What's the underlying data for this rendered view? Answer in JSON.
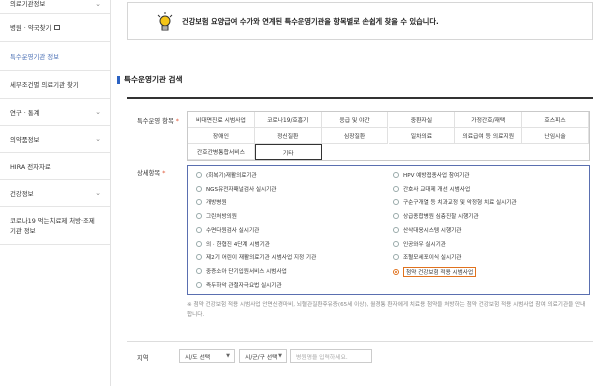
{
  "sidebar": {
    "items": [
      {
        "label": "의료기관정보",
        "chevron": true
      },
      {
        "label": "병원 · 약국찾기",
        "external": true
      },
      {
        "label": "특수운영기관 정보",
        "active": true
      },
      {
        "label": "세부조건별 의료기관 찾기"
      },
      {
        "label": "연구 · 통계",
        "chevron": true
      },
      {
        "label": "의약품정보",
        "chevron": true
      },
      {
        "label": "HIRA 전자자료"
      },
      {
        "label": "건강정보",
        "chevron": true
      },
      {
        "label": "코로나19 먹는치료제 처방·조제 기관 정보",
        "external": true
      }
    ]
  },
  "notice": {
    "text": "건강보험 요양급여 수가와 연계된 특수운영기관을 항목별로 손쉽게 찾을 수 있습니다."
  },
  "section": {
    "title": "특수운영기관 검색"
  },
  "labels": {
    "operation_item": "특수운영 항목",
    "detail_item": "상세항목",
    "region": "지역",
    "required": "*"
  },
  "operation_items": [
    "비대면진료 시범사업",
    "코로나19/호흡기",
    "응급 및 야간",
    "중환자실",
    "가정간호/재택",
    "호스피스",
    "장애인",
    "정신질환",
    "심장질환",
    "일차의료",
    "의료급여 등 의료지원",
    "난임시술",
    "간호간병통합서비스",
    "기타"
  ],
  "operation_selected": "기타",
  "detail_left": [
    "(회복기)재활의료기관",
    "NGS유전자패널검사 실시기관",
    "개방병원",
    "그린처방의원",
    "수면다원검사 실시기관",
    "의 · 한협진 4단계 시범기관",
    "제2기 어린이 재활의료기관 시범사업 지정 기관",
    "중증소아 단기입원서비스 시범사업",
    "즉두하악 관절자극요법 실시기관"
  ],
  "detail_right": [
    "HPV 예방접종사업 참여기관",
    "간호사 교대제 개선 시범사업",
    "구순구개열 등 치과교정 및 악정형 치료 실시기관",
    "상급종합병원 심층진찰 시행기관",
    "산삭대응시스템 시행기관",
    "인공와우 실시기관",
    "조혈모세포이식 실시기관",
    "첨약 건강보험 적용 시범사업"
  ],
  "detail_selected": "첨약 건강보험 적용 시범사업",
  "note": "※ 첨약 건강보험 적용 시범사업 안면신경마비, 뇌혈관질환후유증(65세 이상), 월경통 환자에게 치료용 첨약을 처방하는 첨약 건강보험 적용 시범사업 참여 의료기관을 안내합니다.",
  "region": {
    "sido": "시/도 선택",
    "sigungu": "시/군/구 선택",
    "placeholder": "병원명을 입력하세요."
  }
}
